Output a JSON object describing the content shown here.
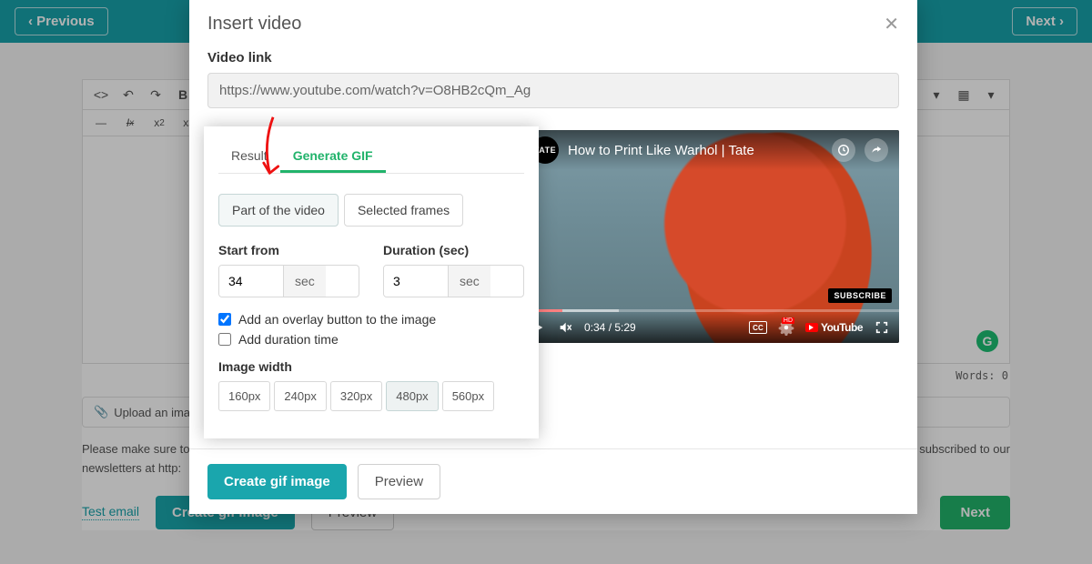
{
  "nav": {
    "prev": "Previous",
    "next": "Next"
  },
  "editor": {
    "upload_hint": "Upload an image",
    "words_label": "Words:",
    "words_count": "0",
    "note_line1": "Please make sure to",
    "note_line2_suffix": "subscribed to our",
    "note_line3": "newsletters at http:"
  },
  "footer": {
    "test_email": "Test email",
    "create_gif": "Create gif image",
    "preview": "Preview",
    "next": "Next"
  },
  "modal": {
    "title": "Insert video",
    "link_label": "Video link",
    "link_value": "https://www.youtube.com/watch?v=O8HB2cQm_Ag",
    "tabs": {
      "result": "Result",
      "generate": "Generate GIF"
    },
    "seg": {
      "part": "Part of the video",
      "frames": "Selected frames"
    },
    "fields": {
      "start_label": "Start from",
      "start_value": "34",
      "duration_label": "Duration (sec)",
      "duration_value": "3",
      "unit": "sec"
    },
    "checks": {
      "overlay": "Add an overlay button to the image",
      "duration": "Add duration time"
    },
    "width_label": "Image width",
    "widths": [
      "160px",
      "240px",
      "320px",
      "480px",
      "560px"
    ],
    "width_active_index": 3
  },
  "video": {
    "title": "How to Print Like Warhol | Tate",
    "channel_badge": "TATE",
    "time_current": "0:34",
    "time_total": "5:29",
    "subscribe": "SUBSCRIBE",
    "youtube": "YouTube"
  }
}
